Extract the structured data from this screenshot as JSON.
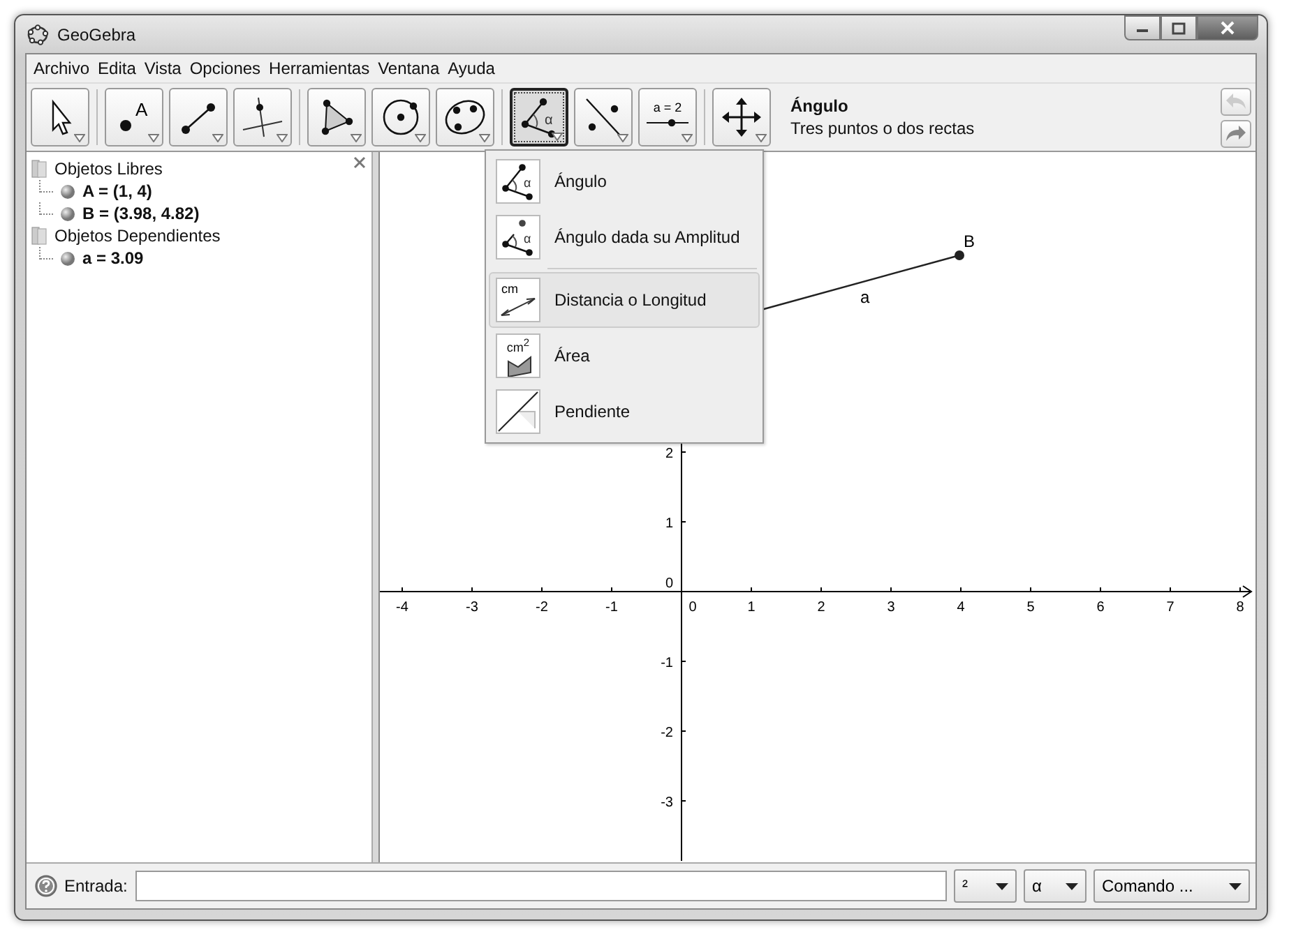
{
  "window": {
    "title": "GeoGebra"
  },
  "menu_bar": [
    "Archivo",
    "Edita",
    "Vista",
    "Opciones",
    "Herramientas",
    "Ventana",
    "Ayuda"
  ],
  "tools": [
    {
      "kind": "move",
      "selected": false
    },
    {
      "kind": "point",
      "label": "A",
      "selected": false
    },
    {
      "kind": "segment",
      "selected": false
    },
    {
      "kind": "perpendicular",
      "selected": false
    },
    {
      "kind": "polygon",
      "selected": false
    },
    {
      "kind": "circle",
      "selected": false
    },
    {
      "kind": "conic",
      "selected": false
    },
    {
      "kind": "angle",
      "label": "α",
      "selected": true
    },
    {
      "kind": "reflect",
      "selected": false
    },
    {
      "kind": "slider",
      "label": "a = 2",
      "selected": false
    },
    {
      "kind": "move-view",
      "selected": false
    }
  ],
  "tool_info": {
    "name": "Ángulo",
    "description": "Tres puntos o dos rectas"
  },
  "undo": {
    "disabled": true
  },
  "redo": {
    "disabled": false
  },
  "tool_menu": [
    {
      "kind": "angle",
      "label": "Ángulo",
      "symbol": "α",
      "selected": false
    },
    {
      "kind": "angle-fixed",
      "label": "Ángulo dada su Amplitud",
      "symbol": "α",
      "selected": false
    },
    {
      "kind": "distance",
      "label": "Distancia o Longitud",
      "symbol": "cm",
      "selected": true
    },
    {
      "kind": "area",
      "label": "Área",
      "symbol": "cm$^{2}$",
      "selected": false
    },
    {
      "kind": "slope",
      "label": "Pendiente",
      "selected": false
    }
  ],
  "algebra_view": {
    "groups": [
      {
        "label": "Objetos Libres",
        "children": [
          {
            "label": "A = (1, 4)"
          },
          {
            "label": "B = (3.98, 4.82)"
          }
        ]
      },
      {
        "label": "Objetos Dependientes",
        "children": [
          {
            "label": "a = 3.09"
          }
        ]
      }
    ]
  },
  "graphics_view": {
    "x_axis_labels": [
      "-4",
      "-3",
      "-2",
      "-1",
      "0",
      "1",
      "2",
      "3",
      "4",
      "5",
      "6",
      "7",
      "8"
    ],
    "y_axis_labels": [
      "2",
      "1",
      "0",
      "-1",
      "-2",
      "-3"
    ],
    "point_label": "B",
    "segment_label": "a"
  },
  "input_bar": {
    "label": "Entrada:",
    "dropdowns": [
      "²",
      "α",
      "Comando ..."
    ]
  }
}
